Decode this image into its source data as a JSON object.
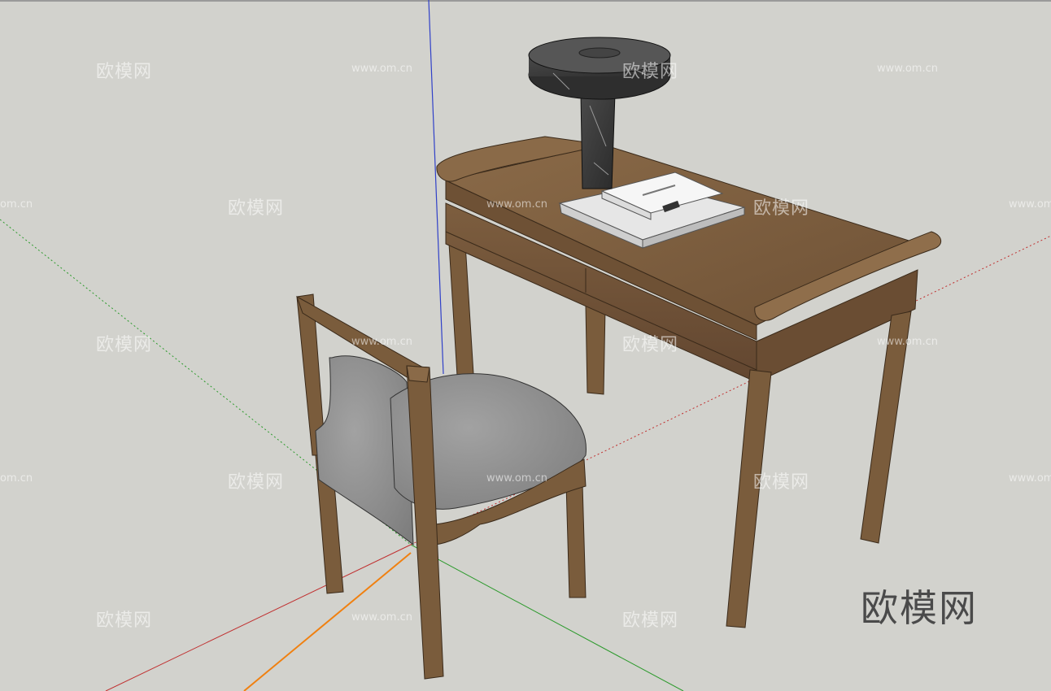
{
  "watermark": {
    "brand": "欧模网",
    "url": "www.om.cn",
    "short_url": "om.cn"
  },
  "big_watermark": "欧模网",
  "colors": {
    "background": "#d2d2cd",
    "wood": "#7a5c3c",
    "wood_dark": "#5b4128",
    "fabric": "#8e8e8e",
    "marble": "#3a3a3a",
    "axis_red": "#c03030",
    "axis_green": "#2c9a2c",
    "axis_blue": "#3040c8",
    "axis_orange": "#f08010"
  },
  "scene": {
    "objects": [
      "axis-lines",
      "desk",
      "chair",
      "table-lamp",
      "books"
    ]
  }
}
